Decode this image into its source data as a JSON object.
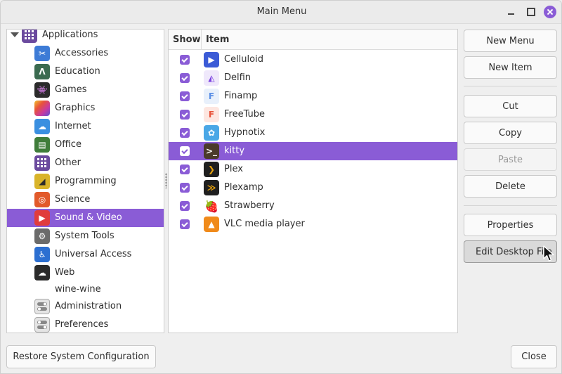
{
  "window": {
    "title": "Main Menu"
  },
  "tree": {
    "root": {
      "label": "Applications",
      "icon": "grid-icon",
      "color": "#6b4a9e"
    },
    "items": [
      {
        "label": "Accessories",
        "icon": "scissors-icon",
        "color": "#3d7bd6"
      },
      {
        "label": "Education",
        "icon": "compass-icon",
        "color": "#3b6b50"
      },
      {
        "label": "Games",
        "icon": "invader-icon",
        "color": "#2b2b2b"
      },
      {
        "label": "Graphics",
        "icon": "rainbow-icon",
        "color": "#d94a8a"
      },
      {
        "label": "Internet",
        "icon": "cloud-icon",
        "color": "#3a8fe0"
      },
      {
        "label": "Office",
        "icon": "document-icon",
        "color": "#3f7d3a"
      },
      {
        "label": "Other",
        "icon": "grid-icon",
        "color": "#6b4a9e"
      },
      {
        "label": "Programming",
        "icon": "triangle-ruler-icon",
        "color": "#d9b42a"
      },
      {
        "label": "Science",
        "icon": "atom-icon",
        "color": "#e25a2b"
      },
      {
        "label": "Sound & Video",
        "icon": "play-icon",
        "color": "#e03c3c",
        "selected": true
      },
      {
        "label": "System Tools",
        "icon": "gear-icon",
        "color": "#6b6b6b"
      },
      {
        "label": "Universal Access",
        "icon": "accessibility-icon",
        "color": "#2c6fd1"
      },
      {
        "label": "Web",
        "icon": "web-cloud-icon",
        "color": "#2b2b2b"
      },
      {
        "label": "wine-wine",
        "icon": "",
        "color": ""
      },
      {
        "label": "Administration",
        "icon": "toggle-icon",
        "color": "#8a8a8a"
      },
      {
        "label": "Preferences",
        "icon": "toggle-icon",
        "color": "#8a8a8a"
      }
    ]
  },
  "table": {
    "headers": {
      "show": "Show",
      "item": "Item"
    },
    "rows": [
      {
        "label": "Celluloid",
        "checked": true,
        "icon": "celluloid-icon",
        "color": "#3b5bd6"
      },
      {
        "label": "Delfin",
        "checked": true,
        "icon": "delfin-icon",
        "color": "#7a3fe0"
      },
      {
        "label": "Finamp",
        "checked": true,
        "icon": "finamp-icon",
        "color": "#5a8fe6"
      },
      {
        "label": "FreeTube",
        "checked": true,
        "icon": "freetube-icon",
        "color": "#e8533a"
      },
      {
        "label": "Hypnotix",
        "checked": true,
        "icon": "hypnotix-icon",
        "color": "#4aa7e6"
      },
      {
        "label": "kitty",
        "checked": true,
        "icon": "kitty-icon",
        "color": "#4a3a2a",
        "selected": true
      },
      {
        "label": "Plex",
        "checked": true,
        "icon": "plex-icon",
        "color": "#1f1f1f"
      },
      {
        "label": "Plexamp",
        "checked": true,
        "icon": "plexamp-icon",
        "color": "#1f1f1f"
      },
      {
        "label": "Strawberry",
        "checked": true,
        "icon": "strawberry-icon",
        "color": "#d62a2a"
      },
      {
        "label": "VLC media player",
        "checked": true,
        "icon": "vlc-icon",
        "color": "#f08a1a"
      }
    ]
  },
  "buttons": {
    "new_menu": "New Menu",
    "new_item": "New Item",
    "cut": "Cut",
    "copy": "Copy",
    "paste": "Paste",
    "delete": "Delete",
    "properties": "Properties",
    "edit_desktop_file": "Edit Desktop File",
    "restore": "Restore System Configuration",
    "close": "Close"
  },
  "colors": {
    "accent": "#8a5cd6"
  }
}
